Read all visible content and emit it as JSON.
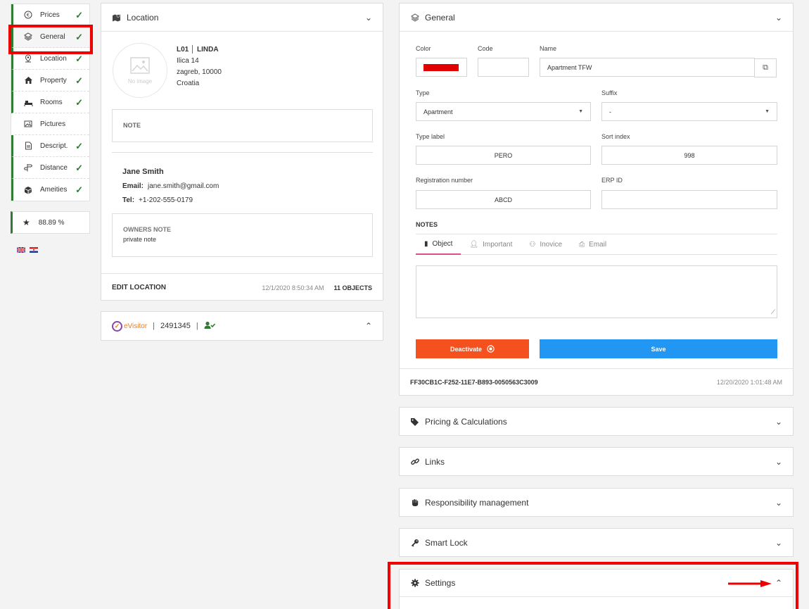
{
  "sidebar": {
    "items": [
      {
        "label": "Prices",
        "icon": "euro-icon",
        "checked": true
      },
      {
        "label": "General",
        "icon": "layers-icon",
        "checked": true
      },
      {
        "label": "Location",
        "icon": "map-pin-icon",
        "checked": true
      },
      {
        "label": "Property",
        "icon": "house-icon",
        "checked": true
      },
      {
        "label": "Rooms",
        "icon": "bed-icon",
        "checked": true
      },
      {
        "label": "Pictures",
        "icon": "image-icon",
        "checked": false
      },
      {
        "label": "Descript.",
        "icon": "document-icon",
        "checked": true
      },
      {
        "label": "Distance",
        "icon": "signpost-icon",
        "checked": true
      },
      {
        "label": "Ameities",
        "icon": "box-icon",
        "checked": true
      }
    ],
    "score": "88.89 %"
  },
  "location": {
    "title": "Location",
    "no_image": "No image",
    "code": "L01",
    "name": "LINDA",
    "street": "Ilica 14",
    "city": "zagreb, 10000",
    "country": "Croatia",
    "note_label": "NOTE",
    "contact_name": "Jane Smith",
    "email_label": "Email:",
    "email": "jane.smith@gmail.com",
    "tel_label": "Tel:",
    "tel": "+1-202-555-0179",
    "owners_note_label": "OWNERS NOTE",
    "owners_note": "private note",
    "edit_label": "EDIT LOCATION",
    "timestamp": "12/1/2020 8:50:34 AM",
    "objects": "11 OBJECTS"
  },
  "evisitor": {
    "logo": "eVisitor",
    "id": "2491345"
  },
  "general": {
    "title": "General",
    "color_label": "Color",
    "color_value": "#e00000",
    "code_label": "Code",
    "code_value": "",
    "name_label": "Name",
    "name_value": "Apartment TFW",
    "type_label": "Type",
    "type_value": "Apartment",
    "suffix_label": "Suffix",
    "suffix_value": "-",
    "typelabel_label": "Type label",
    "typelabel_value": "PERO",
    "sort_label": "Sort index",
    "sort_value": "998",
    "reg_label": "Registration number",
    "reg_value": "ABCD",
    "erp_label": "ERP ID",
    "erp_value": "",
    "notes_title": "NOTES",
    "tabs": [
      {
        "label": "Object",
        "active": true
      },
      {
        "label": "Important",
        "active": false
      },
      {
        "label": "Inovice",
        "active": false
      },
      {
        "label": "Email",
        "active": false
      }
    ],
    "deactivate_label": "Deactivate",
    "save_label": "Save",
    "guid": "FF30CB1C-F252-11E7-B893-0050563C3009",
    "timestamp": "12/20/2020 1:01:48 AM"
  },
  "sections": [
    {
      "label": "Pricing & Calculations",
      "icon": "tag-icon"
    },
    {
      "label": "Links",
      "icon": "link-icon"
    },
    {
      "label": "Responsibility management",
      "icon": "hand-icon"
    },
    {
      "label": "Smart Lock",
      "icon": "key-icon"
    },
    {
      "label": "Settings",
      "icon": "gear-icon"
    }
  ]
}
